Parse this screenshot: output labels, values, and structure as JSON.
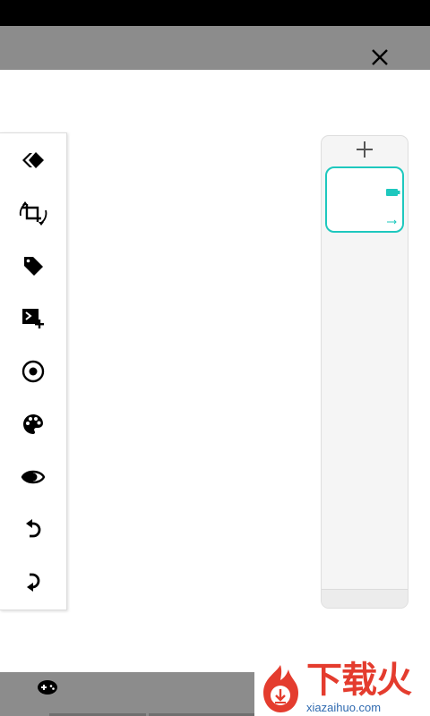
{
  "status_bar": {
    "background": "#000000"
  },
  "title_bar": {
    "background": "#8c8c8c",
    "close_icon": "close-icon"
  },
  "tool_panel": {
    "tools": [
      {
        "id": "erase",
        "icon": "eraser-diamond-icon"
      },
      {
        "id": "crop-rotate",
        "icon": "crop-rotate-icon"
      },
      {
        "id": "tag",
        "icon": "tag-icon"
      },
      {
        "id": "add-media",
        "icon": "add-media-icon"
      },
      {
        "id": "visibility",
        "icon": "radio-target-icon"
      },
      {
        "id": "palette",
        "icon": "palette-icon"
      },
      {
        "id": "contrast",
        "icon": "contrast-eye-icon"
      },
      {
        "id": "undo",
        "icon": "undo-icon"
      },
      {
        "id": "redo",
        "icon": "redo-icon"
      }
    ]
  },
  "layers_panel": {
    "add_icon": "plus-icon",
    "accent_color": "#1ec8be",
    "layers": [
      {
        "selected": true,
        "icon": "battery-icon"
      }
    ]
  },
  "bottom_bar": {
    "background": "#8c8c8c",
    "icon": "controller-pill-icon"
  },
  "watermark": {
    "title": "下载火",
    "subtitle": "xiazaihuo.com",
    "title_color": "#e43c2e",
    "subtitle_color": "#2f6ab0"
  }
}
